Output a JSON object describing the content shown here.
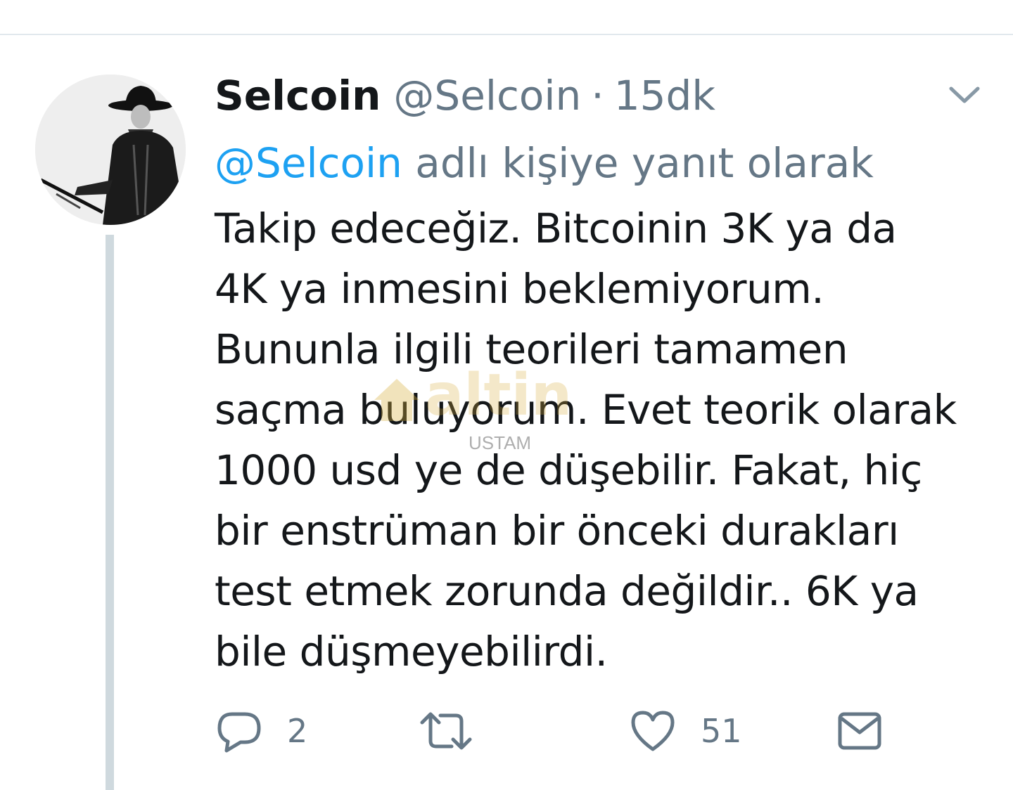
{
  "tweet": {
    "display_name": "Selcoin",
    "handle": "@Selcoin",
    "separator": "·",
    "timestamp": "15dk",
    "reply_to": {
      "mention": "@Selcoin",
      "suffix": " adlı kişiye yanıt olarak"
    },
    "body": "Takip edeceğiz. Bitcoinin 3K ya da\n4K ya inmesini beklemiyorum.\nBununla ilgili teorileri tamamen\nsaçma buluyorum. Evet teorik olarak\n1000 usd ye de düşebilir. Fakat, hiç\nbir enstrüman bir önceki durakları\ntest etmek zorunda değildir.. 6K ya\nbile düşmeyebilirdi."
  },
  "actions": {
    "reply": {
      "icon": "reply-icon",
      "count": "2"
    },
    "retweet": {
      "icon": "retweet-icon",
      "count": ""
    },
    "like": {
      "icon": "heart-icon",
      "count": "51"
    },
    "dm": {
      "icon": "envelope-icon"
    }
  },
  "watermark": {
    "logo_text": "altin",
    "caption": "USTAM"
  },
  "colors": {
    "text_primary": "#14171a",
    "text_secondary": "#657786",
    "link": "#1da1f2",
    "thread_line": "#cfd9de",
    "divider": "#e1e8ed"
  }
}
